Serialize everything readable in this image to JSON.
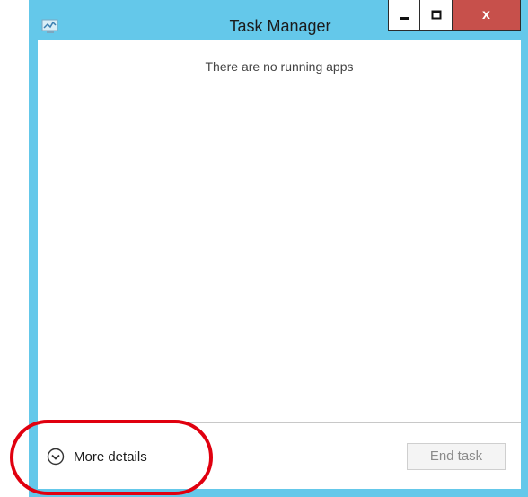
{
  "window": {
    "title": "Task Manager",
    "icon": "task-manager-icon",
    "controls": {
      "minimize": "minimize",
      "maximize": "maximize",
      "close": "x"
    }
  },
  "content": {
    "empty_message": "There are no running apps"
  },
  "footer": {
    "more_details_label": "More details",
    "more_details_icon": "chevron-down-circle-icon",
    "end_task_label": "End task",
    "end_task_enabled": false
  },
  "colors": {
    "title_bar": "#64c8ea",
    "close_button": "#c7504b",
    "annotation": "#e0000f"
  }
}
